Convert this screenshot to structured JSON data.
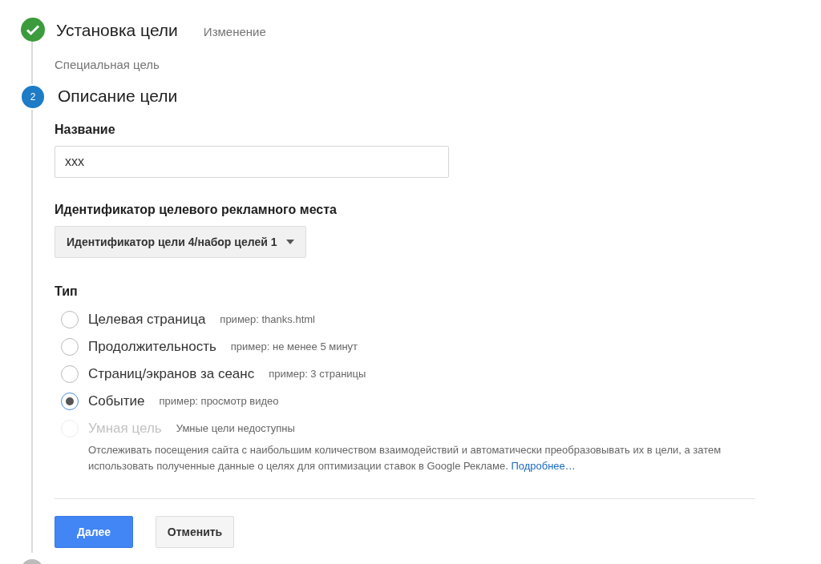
{
  "steps": [
    {
      "kind": "done",
      "title": "Установка цели",
      "action": "Изменение",
      "summary": "Специальная цель"
    },
    {
      "kind": "current",
      "number": "2",
      "title": "Описание цели"
    },
    {
      "kind": "pending"
    }
  ],
  "form": {
    "name_label": "Название",
    "name_value": "xxx",
    "slot_label": "Идентификатор целевого рекламного места",
    "slot_value": "Идентификатор цели 4/набор целей 1",
    "type_label": "Тип",
    "types": [
      {
        "label": "Целевая страница",
        "hint": "пример: thanks.html",
        "selected": false,
        "disabled": false
      },
      {
        "label": "Продолжительность",
        "hint": "пример: не менее 5 минут",
        "selected": false,
        "disabled": false
      },
      {
        "label": "Страниц/экранов за сеанс",
        "hint": "пример: 3 страницы",
        "selected": false,
        "disabled": false
      },
      {
        "label": "Событие",
        "hint": "пример: просмотр видео",
        "selected": true,
        "disabled": false
      },
      {
        "label": "Умная цель",
        "hint": "Умные цели недоступны",
        "selected": false,
        "disabled": true,
        "description": "Отслеживать посещения сайта с наибольшим количеством взаимодействий и автоматически преобразовывать их в цели, а затем использовать полученные данные о целях для оптимизации ставок в Google Рекламе.",
        "link": "Подробнее…"
      }
    ]
  },
  "buttons": [
    {
      "label": "Далее",
      "kind": "primary"
    },
    {
      "label": "Отменить",
      "kind": "secondary"
    }
  ]
}
